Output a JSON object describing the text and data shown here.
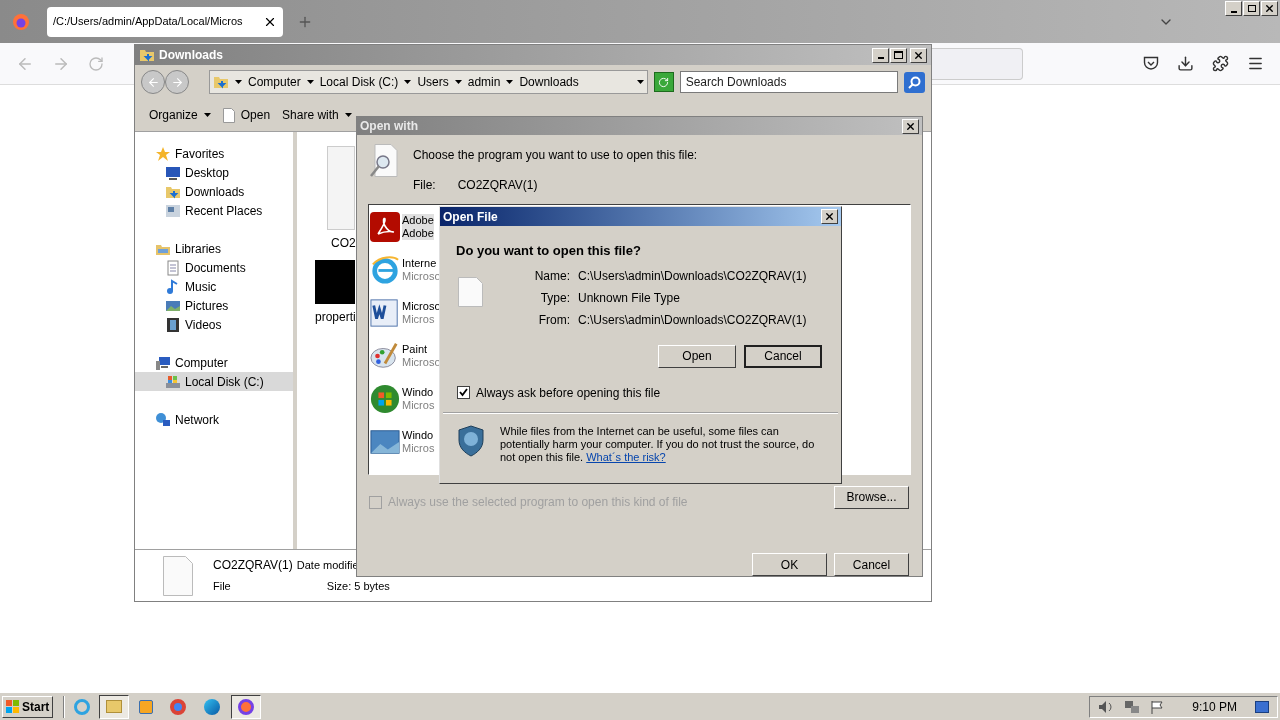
{
  "browser": {
    "tab": {
      "title": "/C:/Users/admin/AppData/Local/Micros"
    }
  },
  "explorer": {
    "title": "Downloads",
    "breadcrumb": [
      "Computer",
      "Local Disk (C:)",
      "Users",
      "admin",
      "Downloads"
    ],
    "search": {
      "placeholder": "Search Downloads"
    },
    "toolbar": [
      {
        "label": "Organize",
        "kind": "menu"
      },
      {
        "label": "Open",
        "kind": "action"
      },
      {
        "label": "Share with",
        "kind": "menu"
      }
    ],
    "nav": [
      {
        "label": "Favorites",
        "kind": "star",
        "selected": false,
        "children": [
          {
            "label": "Desktop",
            "kind": "desktop",
            "selected": false
          },
          {
            "label": "Downloads",
            "kind": "downloads",
            "selected": false
          },
          {
            "label": "Recent Places",
            "kind": "recent",
            "selected": false
          }
        ]
      },
      {
        "label": "Libraries",
        "kind": "library",
        "selected": false,
        "children": [
          {
            "label": "Documents",
            "kind": "documents",
            "selected": false
          },
          {
            "label": "Music",
            "kind": "music",
            "selected": false
          },
          {
            "label": "Pictures",
            "kind": "pictures",
            "selected": false
          },
          {
            "label": "Videos",
            "kind": "videos",
            "selected": false
          }
        ]
      },
      {
        "label": "Computer",
        "kind": "computer",
        "selected": false,
        "children": [
          {
            "label": "Local Disk (C:)",
            "kind": "disk",
            "selected": true
          }
        ]
      },
      {
        "label": "Network",
        "kind": "network",
        "selected": false
      }
    ],
    "files": [
      {
        "name": "CO2",
        "kind": "document"
      },
      {
        "name": "properti",
        "kind": "image"
      }
    ],
    "details": {
      "name": "CO2ZQRAV(1)",
      "date_label": "Date modifie",
      "type": "File",
      "size": "Size: 5 bytes"
    }
  },
  "open_with": {
    "title": "Open with",
    "prompt": "Choose the program you want to use to open this file:",
    "file_label": "File:",
    "file_name": "CO2ZQRAV(1)",
    "programs": [
      {
        "name": "Adobe",
        "publisher": "Adobe",
        "kind": "pdf",
        "selected": true
      },
      {
        "name": "Interne",
        "publisher": "Microso",
        "kind": "browser",
        "selected": false
      },
      {
        "name": "Microso",
        "publisher": "Micros",
        "kind": "word",
        "selected": false
      },
      {
        "name": "Paint",
        "publisher": "Microso",
        "kind": "paint",
        "selected": false
      },
      {
        "name": "Windo",
        "publisher": "Micros",
        "kind": "media",
        "selected": false
      },
      {
        "name": "Windo",
        "publisher": "Micros",
        "kind": "photo",
        "selected": false
      }
    ],
    "always_use": {
      "label": "Always use the selected program to open this kind of file",
      "checked": false,
      "disabled": true
    },
    "browse": "Browse...",
    "ok": "OK",
    "cancel": "Cancel"
  },
  "open_file": {
    "title": "Open File",
    "question": "Do you want to open this file?",
    "fields": [
      {
        "label": "Name:",
        "value": "C:\\Users\\admin\\Downloads\\CO2ZQRAV(1)"
      },
      {
        "label": "Type:",
        "value": "Unknown File Type"
      },
      {
        "label": "From:",
        "value": "C:\\Users\\admin\\Downloads\\CO2ZQRAV(1)"
      }
    ],
    "buttons": [
      {
        "label": "Open",
        "default": false
      },
      {
        "label": "Cancel",
        "default": true
      }
    ],
    "always_ask": {
      "label": "Always ask before opening this file",
      "checked": true
    },
    "warning": "While files from the Internet can be useful, some files can potentially harm your computer. If you do not trust the source, do not open this file.",
    "risk_link": "What´s the risk?"
  },
  "taskbar": {
    "start": "Start",
    "clock": "9:10 PM"
  }
}
